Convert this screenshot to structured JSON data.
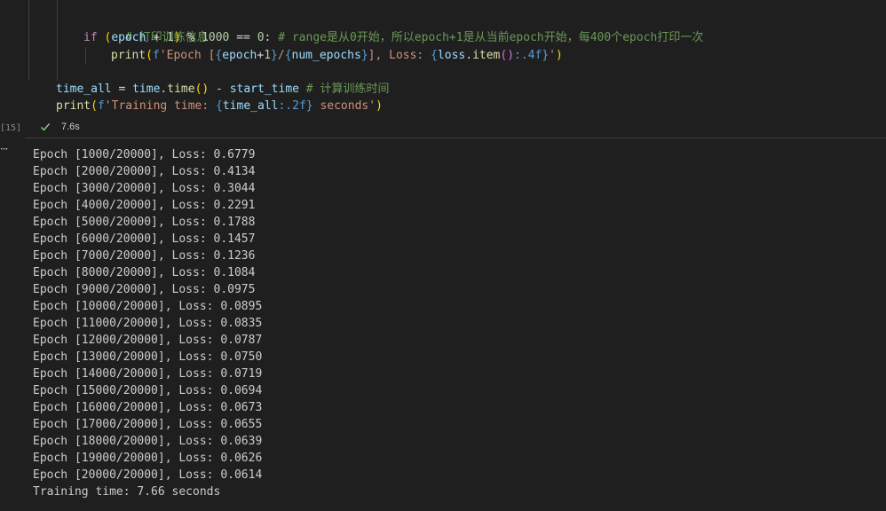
{
  "code": {
    "line_comment": "# 打印训练信息",
    "line_if_kw": "if",
    "line_if_p1": "(",
    "line_if_var": "epoch",
    "line_if_rest": " + ",
    "line_if_one": "1",
    "line_if_p2": ")",
    "line_if_op": " % ",
    "line_if_num": "1000",
    "line_if_eq": " == ",
    "line_if_zero": "0",
    "line_if_colon": ": ",
    "line_if_comment": "# range是从0开始，所以epoch+1是从当前epoch开始，每400个epoch打印一次",
    "print1_fn": "print",
    "print1_p1": "(",
    "print1_f": "f",
    "print1_s1": "'Epoch [",
    "print1_b1": "{",
    "print1_v1": "epoch",
    "print1_op1": "+",
    "print1_n1": "1",
    "print1_b2": "}",
    "print1_s2": "/",
    "print1_b3": "{",
    "print1_v2": "num_epochs",
    "print1_b4": "}",
    "print1_s3": "], Loss: ",
    "print1_b5": "{",
    "print1_v3": "loss",
    "print1_dot": ".",
    "print1_fn2": "item",
    "print1_pp": "()",
    "print1_fmt": ":.4f",
    "print1_b6": "}",
    "print1_s4": "'",
    "print1_p2": ")",
    "time_var": "time_all",
    "time_eq": " = ",
    "time_mod": "time",
    "time_dot": ".",
    "time_fn": "time",
    "time_pp": "()",
    "time_minus": " - ",
    "time_start": "start_time",
    "time_comment": " # 计算训练时间",
    "print2_fn": "print",
    "print2_p1": "(",
    "print2_f": "f",
    "print2_s1": "'Training time: ",
    "print2_b1": "{",
    "print2_v1": "time_all",
    "print2_fmt": ":.2f",
    "print2_b2": "}",
    "print2_s2": " seconds'",
    "print2_p2": ")"
  },
  "cell": {
    "exec_count": "[15]",
    "status_time": "7.6s",
    "output_toggle": "···"
  },
  "output": [
    "Epoch [1000/20000], Loss: 0.6779",
    "Epoch [2000/20000], Loss: 0.4134",
    "Epoch [3000/20000], Loss: 0.3044",
    "Epoch [4000/20000], Loss: 0.2291",
    "Epoch [5000/20000], Loss: 0.1788",
    "Epoch [6000/20000], Loss: 0.1457",
    "Epoch [7000/20000], Loss: 0.1236",
    "Epoch [8000/20000], Loss: 0.1084",
    "Epoch [9000/20000], Loss: 0.0975",
    "Epoch [10000/20000], Loss: 0.0895",
    "Epoch [11000/20000], Loss: 0.0835",
    "Epoch [12000/20000], Loss: 0.0787",
    "Epoch [13000/20000], Loss: 0.0750",
    "Epoch [14000/20000], Loss: 0.0719",
    "Epoch [15000/20000], Loss: 0.0694",
    "Epoch [16000/20000], Loss: 0.0673",
    "Epoch [17000/20000], Loss: 0.0655",
    "Epoch [18000/20000], Loss: 0.0639",
    "Epoch [19000/20000], Loss: 0.0626",
    "Epoch [20000/20000], Loss: 0.0614",
    "Training time: 7.66 seconds"
  ],
  "icons": {
    "status": "check-icon",
    "toggle": "ellipsis-icon"
  },
  "colors": {
    "success": "#89d185",
    "background": "#1f1f1f"
  }
}
